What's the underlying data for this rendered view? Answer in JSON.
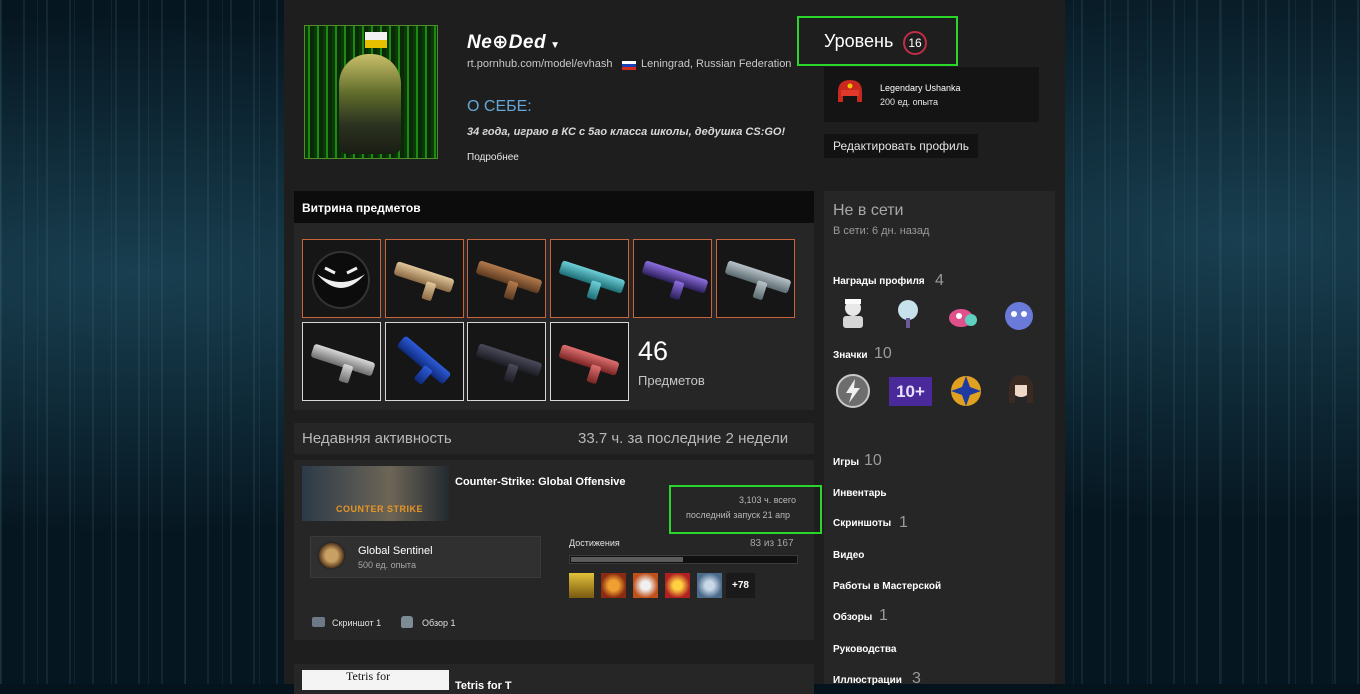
{
  "profile": {
    "name": "Ne⊕Ded",
    "caret": "▼",
    "url": "rt.pornhub.com/model/evhash",
    "location": "Leningrad, Russian Federation",
    "about_title": "О СЕБЕ:",
    "about_text": "34 года, играю в КС с 5ао класса школы, дедушка CS:GO!",
    "more_link": "Подробнее"
  },
  "level": {
    "label": "Уровень",
    "value": "16"
  },
  "badge": {
    "name": "Legendary Ushanka",
    "xp": "200 ед. опыта"
  },
  "edit_button": "Редактировать профиль",
  "showcase": {
    "title": "Витрина предметов",
    "count": "46",
    "count_label": "Предметов"
  },
  "activity": {
    "title": "Недавняя активность",
    "hours_summary": "33.7 ч. за последние 2 недели",
    "game1": {
      "logo_text": "COUNTER STRIKE",
      "title": "Counter-Strike: Global Offensive",
      "hours_total": "3,103 ч. всего",
      "last_played": "последний запуск 21 апр",
      "rank_name": "Global Sentinel",
      "rank_xp": "500 ед. опыта",
      "achievements_label": "Достижения",
      "achievements_count": "83 из 167",
      "achievements_progress": 0.497,
      "achievements_more": "+78",
      "screenshot_label": "Скриншот 1",
      "review_label": "Обзор 1"
    },
    "game2": {
      "image_text": "Tetris for",
      "title": "Tetris for T"
    }
  },
  "sidebar": {
    "status": "Не в сети",
    "last_seen": "В сети: 6 дн. назад",
    "awards_label": "Награды профиля",
    "awards_count": "4",
    "badges_label": "Значки",
    "badges_count": "10",
    "badge_10_text": "10+",
    "games_label": "Игры",
    "games_count": "10",
    "inventory_label": "Инвентарь",
    "screenshots_label": "Скриншоты",
    "screenshots_count": "1",
    "videos_label": "Видео",
    "workshop_label": "Работы в Мастерской",
    "reviews_label": "Обзоры",
    "reviews_count": "1",
    "guides_label": "Руководства",
    "artwork_label": "Иллюстрации",
    "artwork_count": "3"
  },
  "colors": {
    "accent_blue": "#65a8d8",
    "highlight_green": "#2bd62b",
    "level_ring": "#c02d46",
    "item_border_covert": "#c7643c"
  }
}
